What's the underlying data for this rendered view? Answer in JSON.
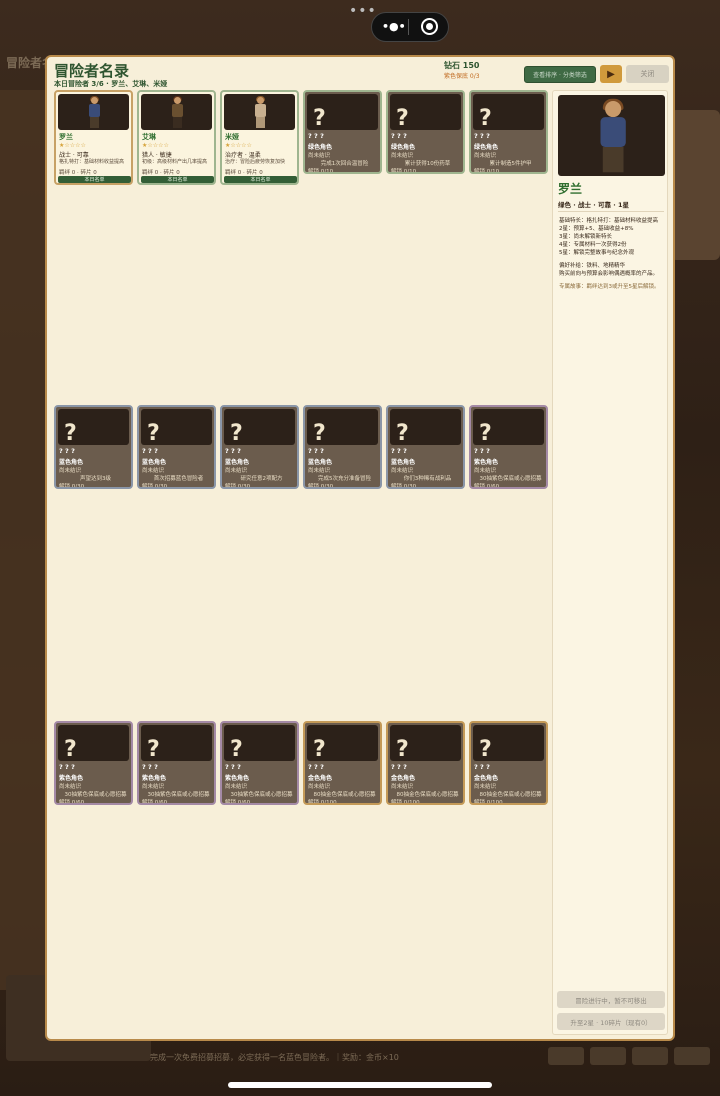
{
  "background": {
    "title": "冒险者名",
    "footer": "完成一次免费招募招募，必定获得一名蓝色冒险者。｜奖励：金币×10"
  },
  "modal": {
    "title": "冒险者名录",
    "subtitle": "本日冒险者 3/6 · 罗兰、艾琳、米娅",
    "diamond": "钻石 150",
    "purple_cap": "紫色保底 0/3",
    "green_button": "查看排序 · 分类筛选",
    "play_icon": "▶",
    "close_button": "关闭",
    "today_badge": "本日名单"
  },
  "known": [
    {
      "name": "罗兰",
      "stars": "★☆☆☆☆",
      "cls": "战士 · 可靠",
      "desc": "格扎特打：基础材料收益提高",
      "prog": "羁绊 0 · 碎片 0"
    },
    {
      "name": "艾琳",
      "stars": "★☆☆☆☆",
      "cls": "猎人 · 敏捷",
      "desc": "初级：高级材料产出几率提高",
      "prog": "羁绊 0 · 碎片 0"
    },
    {
      "name": "米娅",
      "stars": "★☆☆☆☆",
      "cls": "治疗者 · 温柔",
      "desc": "治疗：冒险后疲劳恢复加快",
      "prog": "羁绊 0 · 碎片 0"
    }
  ],
  "locked": [
    {
      "nm": "? ? ?",
      "cls": "绿色角色",
      "st": "尚未结识",
      "req": "完成1次回合温冒险",
      "prog": "解锁 0/10"
    },
    {
      "nm": "? ? ?",
      "cls": "绿色角色",
      "st": "尚未结识",
      "req": "累计获得10份药草",
      "prog": "解锁 0/10"
    },
    {
      "nm": "? ? ?",
      "cls": "绿色角色",
      "st": "尚未结识",
      "req": "累计制造5件护甲",
      "prog": "解锁 0/10"
    },
    {
      "nm": "? ? ?",
      "cls": "蓝色角色",
      "st": "尚未结识",
      "req": "声望达到3级",
      "prog": "解锁 0/30"
    },
    {
      "nm": "? ? ?",
      "cls": "蓝色角色",
      "st": "尚未结识",
      "req": "首次招募蓝色冒险者",
      "prog": "解锁 0/30"
    },
    {
      "nm": "? ? ?",
      "cls": "蓝色角色",
      "st": "尚未结识",
      "req": "研究任意2项配方",
      "prog": "解锁 0/30"
    },
    {
      "nm": "? ? ?",
      "cls": "蓝色角色",
      "st": "尚未结识",
      "req": "完成5次充分准备冒险",
      "prog": "解锁 0/30"
    },
    {
      "nm": "? ? ?",
      "cls": "蓝色角色",
      "st": "尚未结识",
      "req": "你们3种稀有战利品",
      "prog": "解锁 0/30"
    },
    {
      "nm": "? ? ?",
      "cls": "紫色角色",
      "st": "尚未结识",
      "req": "30抽紫色保底或心愿招募",
      "prog": "解锁 0/60"
    },
    {
      "nm": "? ? ?",
      "cls": "紫色角色",
      "st": "尚未结识",
      "req": "30抽紫色保底或心愿招募",
      "prog": "解锁 0/60"
    },
    {
      "nm": "? ? ?",
      "cls": "紫色角色",
      "st": "尚未结识",
      "req": "30抽紫色保底或心愿招募",
      "prog": "解锁 0/60"
    },
    {
      "nm": "? ? ?",
      "cls": "紫色角色",
      "st": "尚未结识",
      "req": "30抽紫色保底或心愿招募",
      "prog": "解锁 0/60"
    },
    {
      "nm": "? ? ?",
      "cls": "金色角色",
      "st": "尚未结识",
      "req": "80抽金色保底或心愿招募",
      "prog": "解锁 0/100"
    },
    {
      "nm": "? ? ?",
      "cls": "金色角色",
      "st": "尚未结识",
      "req": "80抽金色保底或心愿招募",
      "prog": "解锁 0/100"
    },
    {
      "nm": "? ? ?",
      "cls": "金色角色",
      "st": "尚未结识",
      "req": "80抽金色保底或心愿招募",
      "prog": "解锁 0/100"
    }
  ],
  "detail": {
    "name": "罗兰",
    "sub": "绿色 · 战士 · 可靠 · 1星",
    "l1": "基础特长：格扎特打：基础材料收益提高",
    "l2": "2星：预算+5、基础收益+8%",
    "l3": "3星：尚未解锁新特长",
    "l4": "4星：专属材料一次获得2份",
    "l5": "5星：解锁完整故事与纪念外观",
    "l6": "偏好补给：铁料、地精精华",
    "l7": "购买前向与预算会影响偶遇概率的产品。",
    "note": "专属故事：羁绊达到3或升至5星后解锁。",
    "btn1": "冒险进行中，暂不可移出",
    "btn2": "升至2星 · 10碎片（现有0）"
  },
  "colors": {
    "green_border": "#9fb58f",
    "blue_border": "#8a96a8",
    "purple_border": "#a48aa6",
    "gold_border": "#c49a58"
  }
}
